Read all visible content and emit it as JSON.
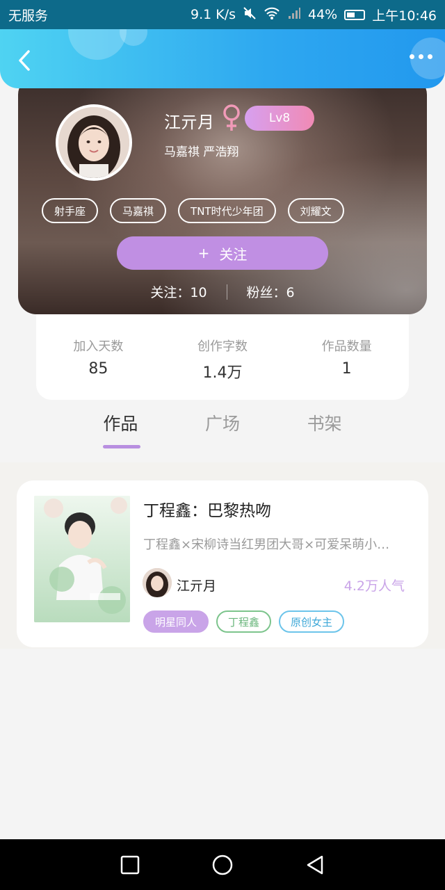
{
  "status_bar": {
    "carrier": "无服务",
    "speed": "9.1 K/s",
    "battery": "44%",
    "time": "上午10:46"
  },
  "profile": {
    "username": "江亓月",
    "level": "Lv8",
    "favorites": "马嘉祺 严浩翔",
    "tags": [
      "射手座",
      "马嘉祺",
      "TNT时代少年团",
      "刘耀文"
    ],
    "follow_button_plus": "+",
    "follow_button_label": "关注",
    "following": "关注：10",
    "fans": "粉丝：6"
  },
  "stats": [
    {
      "label": "加入天数",
      "value": "85"
    },
    {
      "label": "创作字数",
      "value": "1.4万"
    },
    {
      "label": "作品数量",
      "value": "1"
    }
  ],
  "tabs": [
    {
      "label": "作品",
      "active": true
    },
    {
      "label": "广场",
      "active": false
    },
    {
      "label": "书架",
      "active": false
    }
  ],
  "work": {
    "title": "丁程鑫：巴黎热吻",
    "description": "丁程鑫×宋柳诗当红男团大哥×可爱呆萌小…",
    "author": "江亓月",
    "popularity": "4.2万人气",
    "tags": [
      {
        "label": "明星同人",
        "color": "#ffffff",
        "bg": "#c9a4e8",
        "border": "#c9a4e8"
      },
      {
        "label": "丁程鑫",
        "color": "#6cb77e",
        "bg": "#ffffff",
        "border": "#7cc48c"
      },
      {
        "label": "原创女主",
        "color": "#3fa8d8",
        "bg": "#ffffff",
        "border": "#6cc4ea"
      }
    ]
  },
  "colors": {
    "header": "#2ea8f0",
    "accent": "#c08fe3",
    "tab_underline": "#b88fe0"
  }
}
